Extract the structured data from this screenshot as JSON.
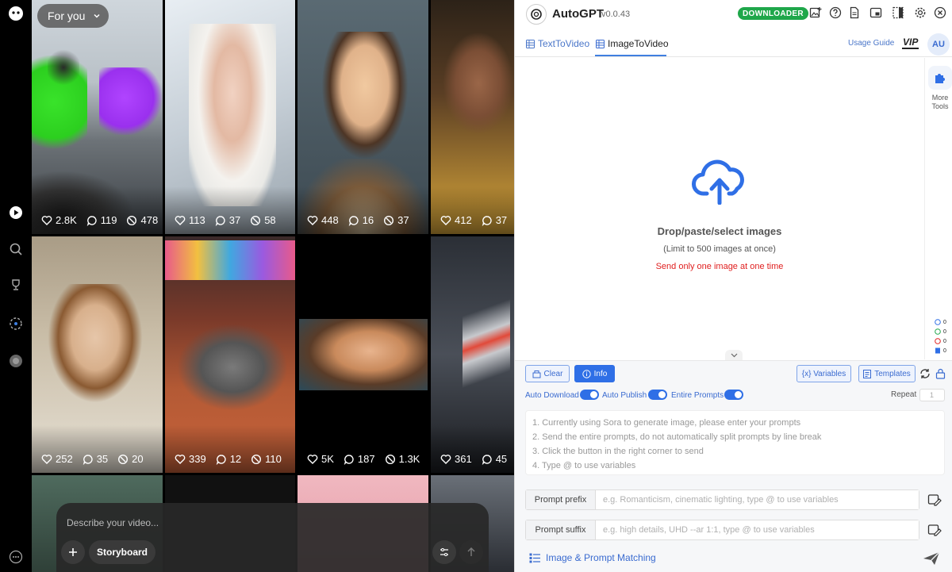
{
  "feed": {
    "tab_label": "For you",
    "tiles": [
      {
        "likes": "2.8K",
        "comments": "119",
        "remixes": "478"
      },
      {
        "likes": "113",
        "comments": "37",
        "remixes": "58"
      },
      {
        "likes": "448",
        "comments": "16",
        "remixes": "37"
      },
      {
        "likes": "412",
        "comments": "37",
        "remixes": ""
      },
      {
        "likes": "252",
        "comments": "35",
        "remixes": "20"
      },
      {
        "likes": "339",
        "comments": "12",
        "remixes": "110"
      },
      {
        "likes": "5K",
        "comments": "187",
        "remixes": "1.3K"
      },
      {
        "likes": "361",
        "comments": "45",
        "remixes": ""
      }
    ],
    "composer_placeholder": "Describe your video...",
    "storyboard_label": "Storyboard"
  },
  "panel": {
    "app_name": "AutoGPT",
    "version": "v0.0.43",
    "downloader_label": "DOWNLOADER",
    "tabs": [
      {
        "label": "TextToVideo"
      },
      {
        "label": "ImageToVideo"
      }
    ],
    "usage_guide": "Usage Guide",
    "vip": "VIP",
    "avatar": "AU",
    "drop_title": "Drop/paste/select images",
    "drop_limit": "(Limit to 500 images at once)",
    "drop_warning": "Send only one image at one time",
    "more_tools": "More Tools",
    "counters": [
      "0",
      "0",
      "0",
      "0"
    ],
    "buttons": {
      "clear": "Clear",
      "info": "Info",
      "variables": "{x} Variables",
      "templates": "Templates"
    },
    "toggles": {
      "auto_download": "Auto Download",
      "auto_publish": "Auto Publish",
      "entire_prompts": "Entire Prompts"
    },
    "repeat_label": "Repeat",
    "repeat_value": "1",
    "prompt_hints": [
      "1. Currently using Sora to generate image, please enter your prompts",
      "2. Send the entire prompts, do not automatically split prompts by line break",
      "3. Click the button in the right corner to send",
      "4. Type @ to use variables"
    ],
    "prefix_label": "Prompt prefix",
    "prefix_placeholder": "e.g. Romanticism, cinematic lighting, type @ to use variables",
    "suffix_label": "Prompt suffix",
    "suffix_placeholder": "e.g. high details, UHD --ar 1:1, type @ to use variables",
    "matching_label": "Image & Prompt Matching",
    "colors": {
      "accent": "#2f6fe6",
      "downloader": "#1fa74a",
      "warning": "#e02020"
    }
  }
}
